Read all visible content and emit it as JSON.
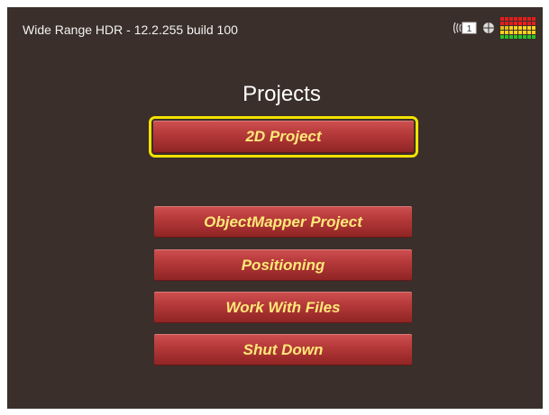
{
  "window": {
    "title": "Wide Range HDR - 12.2.255 build 100"
  },
  "status": {
    "cast_badge": "1",
    "meter": {
      "columns": 8,
      "levels": [
        0.2,
        0.35,
        0.5,
        0.6,
        0.65,
        0.6,
        0.55,
        0.5
      ]
    }
  },
  "main": {
    "title": "Projects",
    "buttons": [
      {
        "id": "2d-project",
        "label": "2D Project",
        "selected": true
      },
      {
        "id": "objectmapper-project",
        "label": "ObjectMapper Project",
        "selected": false
      },
      {
        "id": "positioning",
        "label": "Positioning",
        "selected": false
      },
      {
        "id": "work-with-files",
        "label": "Work With Files",
        "selected": false
      },
      {
        "id": "shut-down",
        "label": "Shut Down",
        "selected": false
      }
    ]
  },
  "colors": {
    "background": "#3a2f2a",
    "button_text": "#ffe878",
    "button_red": "#b63a3a",
    "selection": "#f2e200"
  }
}
